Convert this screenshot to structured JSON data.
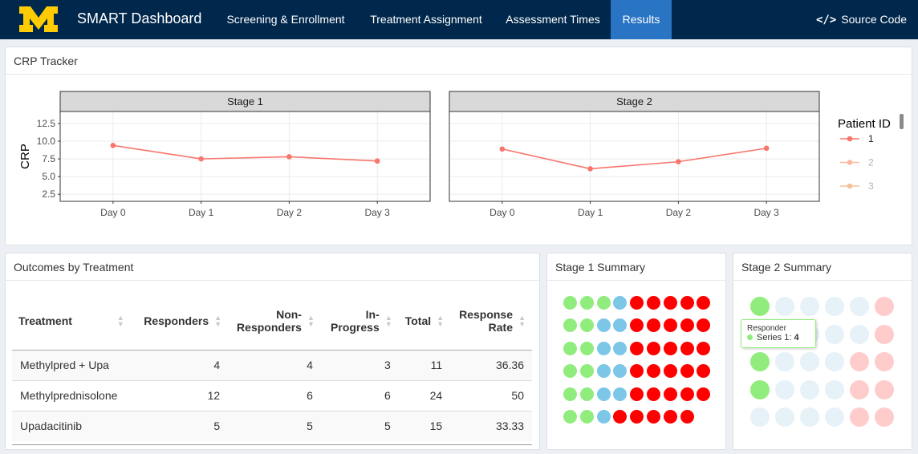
{
  "nav": {
    "brand": "SMART Dashboard",
    "items": [
      "Screening & Enrollment",
      "Treatment Assignment",
      "Assessment Times",
      "Results"
    ],
    "active": "Results",
    "source_label": "Source Code",
    "source_icon": "code-icon",
    "logo_text": "M",
    "brand_color": "#00274c",
    "logo_color": "#ffcb05"
  },
  "crp": {
    "title": "CRP Tracker",
    "chart_data": {
      "type": "line",
      "ylabel": "CRP",
      "facets": [
        {
          "name": "Stage 1",
          "x": [
            "Day 0",
            "Day 1",
            "Day 2",
            "Day 3"
          ],
          "series": [
            {
              "name": "1",
              "values": [
                9.4,
                7.5,
                7.8,
                7.2
              ]
            }
          ]
        },
        {
          "name": "Stage 2",
          "x": [
            "Day 0",
            "Day 1",
            "Day 2",
            "Day 3"
          ],
          "series": [
            {
              "name": "1",
              "values": [
                8.9,
                6.1,
                7.1,
                9.0
              ]
            }
          ]
        }
      ],
      "y_ticks": [
        "2.5",
        "5.0",
        "7.5",
        "10.0",
        "12.5"
      ],
      "ylim": [
        1.5,
        14.2
      ],
      "legend": {
        "title": "Patient ID",
        "entries": [
          "1",
          "2",
          "3"
        ],
        "colors": [
          "#f8766d",
          "#f9b9a0",
          "#f5c198"
        ],
        "placement": "right"
      },
      "grid": true
    }
  },
  "outcomes": {
    "title": "Outcomes by Treatment",
    "columns": [
      "Treatment",
      "Responders",
      "Non-\nResponders",
      "In-\nProgress",
      "Total",
      "Response\nRate"
    ],
    "rows": [
      [
        "Methylpred + Upa",
        "4",
        "4",
        "3",
        "11",
        "36.36"
      ],
      [
        "Methylprednisolone",
        "12",
        "6",
        "6",
        "24",
        "50"
      ],
      [
        "Upadacitinib",
        "5",
        "5",
        "5",
        "15",
        "33.33"
      ]
    ]
  },
  "stage1": {
    "title": "Stage 1 Summary",
    "rows": [
      [
        "g",
        "g",
        "g",
        "b",
        "r",
        "r",
        "r",
        "r",
        "r"
      ],
      [
        "g",
        "g",
        "b",
        "b",
        "r",
        "r",
        "r",
        "r",
        "r"
      ],
      [
        "g",
        "g",
        "b",
        "b",
        "r",
        "r",
        "r",
        "r",
        "r"
      ],
      [
        "g",
        "g",
        "b",
        "b",
        "r",
        "r",
        "r",
        "r",
        "r"
      ],
      [
        "g",
        "g",
        "b",
        "b",
        "r",
        "r",
        "r",
        "r",
        "r"
      ],
      [
        "g",
        "g",
        "b",
        "r",
        "r",
        "r",
        "r",
        "r"
      ]
    ],
    "colors": {
      "g": "#90ed7d",
      "b": "#7cc6e8",
      "r": "#ff0000"
    }
  },
  "stage2": {
    "title": "Stage 2 Summary",
    "rows": [
      [
        "g",
        "b",
        "b",
        "b",
        "b",
        "r"
      ],
      [
        "g",
        "b",
        "b",
        "b",
        "b",
        "r"
      ],
      [
        "g",
        "b",
        "b",
        "b",
        "r",
        "r"
      ],
      [
        "g",
        "b",
        "b",
        "b",
        "r",
        "r"
      ],
      [
        "b",
        "b",
        "b",
        "b",
        "r",
        "r"
      ]
    ],
    "colors": {
      "g": "#90ed7d",
      "b": "#e6f1f8",
      "r": "#ffcccc"
    },
    "tooltip": {
      "category": "Responder",
      "series": "Series 1",
      "value": "4"
    }
  }
}
